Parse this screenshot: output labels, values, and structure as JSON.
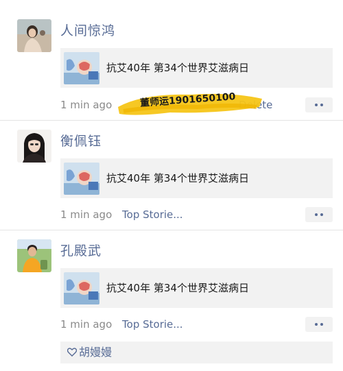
{
  "posts": [
    {
      "author": "人间惊鸿",
      "article_title": "抗艾40年 第34个世界艾滋病日",
      "time": "1 min ago",
      "action": "Delete"
    },
    {
      "author": "衡佩钰",
      "article_title": "抗艾40年 第34个世界艾滋病日",
      "time": "1 min ago",
      "tag": "Top Storie..."
    },
    {
      "author": "孔殿武",
      "article_title": "抗艾40年 第34个世界艾滋病日",
      "time": "1 min ago",
      "tag": "Top Storie...",
      "likes": "胡嫚嫚"
    }
  ],
  "watermark": {
    "text": "董师运1901650100"
  },
  "colors": {
    "link": "#576b95",
    "card_bg": "#f2f2f2",
    "meta": "#8a8a8a",
    "highlight": "#f5c518"
  },
  "icons": {
    "more": "more-dots-icon",
    "like": "heart-icon"
  }
}
